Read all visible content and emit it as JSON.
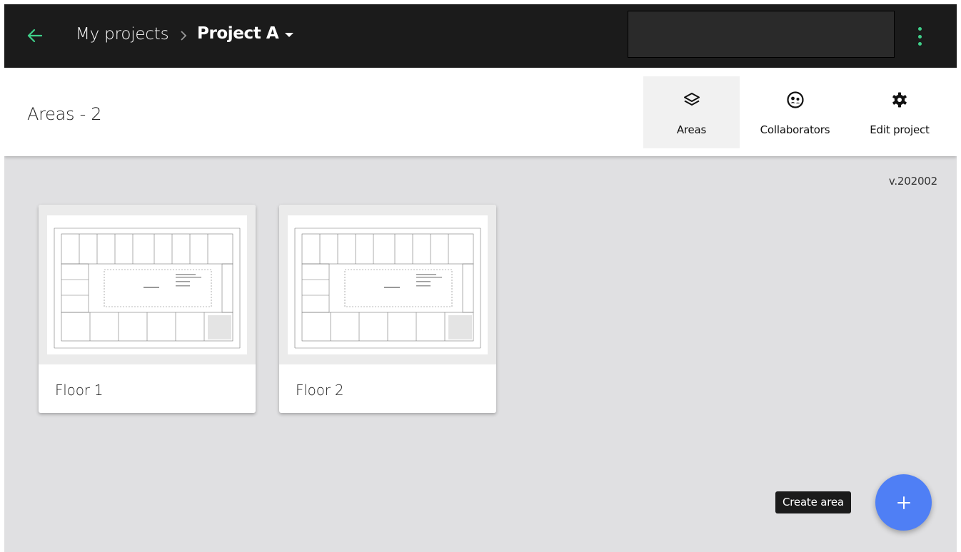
{
  "appbar": {
    "breadcrumb_parent": "My projects",
    "breadcrumb_current": "Project A",
    "accent_color": "#3fd08a",
    "icons": {
      "back": "arrow-left-icon",
      "separator": "chevron-right-icon",
      "caret": "caret-down-icon",
      "menu": "more-vert-icon"
    }
  },
  "header": {
    "title": "Areas - 2",
    "tabs": [
      {
        "label": "Areas",
        "icon": "layers-icon",
        "active": true
      },
      {
        "label": "Collaborators",
        "icon": "collaborators-icon",
        "active": false
      },
      {
        "label": "Edit project",
        "icon": "gear-icon",
        "active": false
      }
    ]
  },
  "version": "v.202002",
  "areas": [
    {
      "name": "Floor 1",
      "thumbnail": "floor-plan-icon"
    },
    {
      "name": "Floor 2",
      "thumbnail": "floor-plan-icon"
    }
  ],
  "create_area": {
    "tooltip": "Create area",
    "icon": "plus-icon",
    "color": "#4f7ff5"
  }
}
